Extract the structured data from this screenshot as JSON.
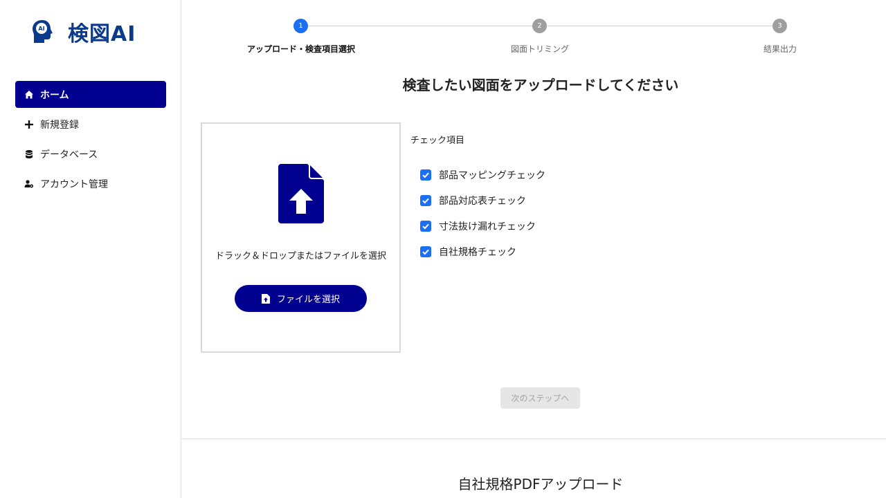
{
  "app": {
    "name": "検図AI",
    "logo_icon": "ai-head-icon",
    "brand_color": "#0a3a8c"
  },
  "sidebar": {
    "items": [
      {
        "label": "ホーム",
        "icon": "home-icon",
        "active": true
      },
      {
        "label": "新規登録",
        "icon": "plus-icon",
        "active": false
      },
      {
        "label": "データベース",
        "icon": "database-icon",
        "active": false
      },
      {
        "label": "アカウント管理",
        "icon": "user-gear-icon",
        "active": false
      }
    ]
  },
  "stepper": {
    "steps": [
      {
        "number": "1",
        "label": "アップロード・検査項目選択",
        "active": true
      },
      {
        "number": "2",
        "label": "図面トリミング",
        "active": false
      },
      {
        "number": "3",
        "label": "結果出力",
        "active": false
      }
    ]
  },
  "main": {
    "heading": "検査したい図面をアップロードしてください",
    "upload": {
      "icon": "file-upload-icon",
      "drop_text": "ドラック＆ドロップまたはファイルを選択",
      "button_label": "ファイルを選択"
    },
    "checks": {
      "title": "チェック項目",
      "items": [
        {
          "label": "部品マッピングチェック",
          "checked": true
        },
        {
          "label": "部品対応表チェック",
          "checked": true
        },
        {
          "label": "寸法抜け漏れチェック",
          "checked": true
        },
        {
          "label": "自社規格チェック",
          "checked": true
        }
      ]
    },
    "next_button": "次のステップへ",
    "bottom_title": "自社規格PDFアップロード"
  },
  "colors": {
    "primary": "#01008f",
    "accent": "#1a6ff5",
    "inactive_step": "#9e9e9e",
    "disabled_bg": "#e6e6e6"
  }
}
